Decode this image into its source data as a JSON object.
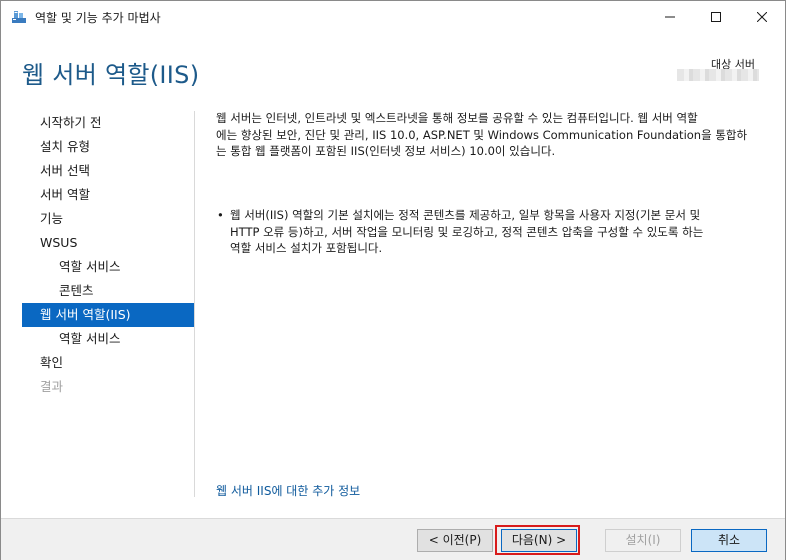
{
  "window": {
    "title": "역할 및 기능 추가 마법사"
  },
  "header": {
    "page_title": "웹 서버 역할(IIS)",
    "destination_label": "대상 서버"
  },
  "nav": {
    "items": [
      {
        "label": "시작하기 전",
        "level": 0,
        "state": "normal"
      },
      {
        "label": "설치 유형",
        "level": 0,
        "state": "normal"
      },
      {
        "label": "서버 선택",
        "level": 0,
        "state": "normal"
      },
      {
        "label": "서버 역할",
        "level": 0,
        "state": "normal"
      },
      {
        "label": "기능",
        "level": 0,
        "state": "normal"
      },
      {
        "label": "WSUS",
        "level": 0,
        "state": "normal"
      },
      {
        "label": "역할 서비스",
        "level": 1,
        "state": "normal"
      },
      {
        "label": "콘텐츠",
        "level": 1,
        "state": "normal"
      },
      {
        "label": "웹 서버 역할(IIS)",
        "level": 0,
        "state": "active"
      },
      {
        "label": "역할 서비스",
        "level": 1,
        "state": "normal"
      },
      {
        "label": "확인",
        "level": 0,
        "state": "normal"
      },
      {
        "label": "결과",
        "level": 0,
        "state": "disabled"
      }
    ]
  },
  "content": {
    "description_lines": [
      "웹 서버는 인터넷, 인트라넷 및 엑스트라넷을 통해 정보를 공유할 수 있는 컴퓨터입니다. 웹 서버 역할",
      "에는 향상된 보안, 진단 및 관리, IIS 10.0, ASP.NET 및 Windows Communication Foundation을 통합하",
      "는 통합 웹 플랫폼이 포함된 IIS(인터넷 정보 서비스) 10.0이 있습니다."
    ],
    "bullet": "•",
    "bullet_lines": [
      "웹 서버(IIS) 역할의 기본 설치에는 정적 콘텐츠를 제공하고, 일부 항목을 사용자 지정(기본 문서 및",
      "HTTP 오류 등)하고, 서버 작업을 모니터링 및 로깅하고, 정적 콘텐츠 압축을 구성할 수 있도록 하는",
      "역할 서비스 설치가 포함됩니다."
    ],
    "more_info_link": "웹 서버 IIS에 대한 추가 정보"
  },
  "footer": {
    "prev_label": "< 이전(P)",
    "next_label": "다음(N) >",
    "install_label": "설치(I)",
    "cancel_label": "취소"
  },
  "colors": {
    "accent": "#0a68c2",
    "title": "#1d5a8a",
    "focus_outline": "#d81b1b"
  },
  "icons": {
    "app": "server-manager-icon",
    "minimize": "minimize-icon",
    "maximize": "maximize-icon",
    "close": "close-icon"
  }
}
